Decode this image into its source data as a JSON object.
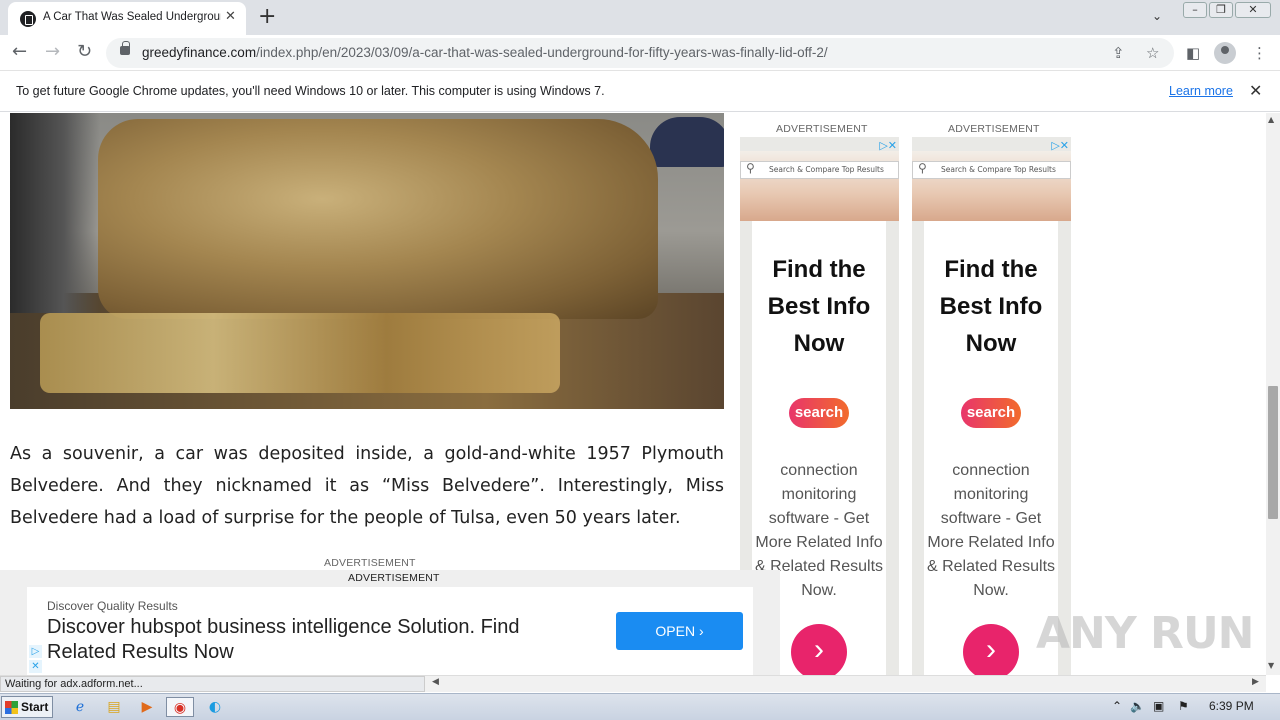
{
  "browser": {
    "tab_title": "A Car That Was Sealed Underground For Fifty Years Was Finally Lid Off",
    "url_domain": "greedyfinance.com",
    "url_path": "/index.php/en/2023/03/09/a-car-that-was-sealed-underground-for-fifty-years-was-finally-lid-off-2/",
    "infobar_message": "To get future Google Chrome updates, you'll need Windows 10 or later. This computer is using Windows 7.",
    "infobar_link": "Learn more",
    "status_text": "Waiting for adx.adform.net..."
  },
  "article": {
    "paragraph": "As a souvenir, a car was deposited inside, a gold-and-white 1957 Plymouth Belvedere. And they nicknamed it as “Miss Belvedere”. Interestingly, Miss Belvedere had a load of surprise for the people of Tulsa, even 50 years later.",
    "ad_label": "ADVERTISEMENT"
  },
  "side_ads": [
    {
      "label": "ADVERTISEMENT",
      "search_text": "Search & Compare Top Results",
      "headline": "Find the Best Info Now",
      "pill": "search",
      "description": "connection monitoring software - Get More Related Info & Related Results Now.",
      "go": "›"
    },
    {
      "label": "ADVERTISEMENT",
      "search_text": "Search & Compare Top Results",
      "headline": "Find the Best Info Now",
      "pill": "search",
      "description": "connection monitoring software - Get More Related Info & Related Results Now.",
      "go": "›"
    }
  ],
  "bottom_ad": {
    "label": "ADVERTISEMENT",
    "small": "Discover Quality Results",
    "headline": "Discover hubspot business intelligence Solution. Find Related Results Now",
    "button": "OPEN ›"
  },
  "watermark": "ANY RUN",
  "taskbar": {
    "start": "Start",
    "clock": "6:39 PM"
  },
  "colors": {
    "accent_blue": "#1a73e8",
    "open_button": "#1a8cf2",
    "pill_gradient_start": "#e8356b",
    "go_button": "#e8246b"
  }
}
